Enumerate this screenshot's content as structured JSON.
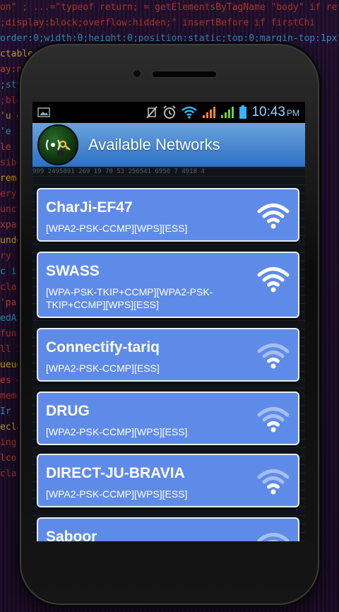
{
  "status_bar": {
    "time": "10:43",
    "ampm": "PM"
  },
  "header": {
    "title": "Available Networks"
  },
  "networks": [
    {
      "ssid": "CharJi-EF47",
      "capabilities": "[WPA2-PSK-CCMP][WPS][ESS]",
      "signal": "strong"
    },
    {
      "ssid": "SWASS",
      "capabilities": "[WPA-PSK-TKIP+CCMP][WPA2-PSK-TKIP+CCMP][WPS][ESS]",
      "signal": "strong"
    },
    {
      "ssid": "Connectify-tariq",
      "capabilities": "[WPA2-PSK-CCMP][ESS]",
      "signal": "weak"
    },
    {
      "ssid": "DRUG",
      "capabilities": "[WPA2-PSK-CCMP][WPS][ESS]",
      "signal": "weak"
    },
    {
      "ssid": "DIRECT-JU-BRAVIA",
      "capabilities": "[WPA2-PSK-CCMP][WPS][ESS]",
      "signal": "weak"
    },
    {
      "ssid": "Saboor",
      "capabilities": "",
      "signal": "weak"
    }
  ],
  "icons": {
    "status_left": "image-notification-icon",
    "mute": "vibrate-mute-icon",
    "alarm": "alarm-icon",
    "wifi": "wifi-status-icon",
    "signal1": "cell-signal-icon",
    "signal2": "cell-signal-icon",
    "battery": "battery-icon"
  },
  "colors": {
    "card": "#5f8be8",
    "header_top": "#6aa3de",
    "header_bottom": "#2d70c4",
    "clock": "#8fd8ff"
  }
}
